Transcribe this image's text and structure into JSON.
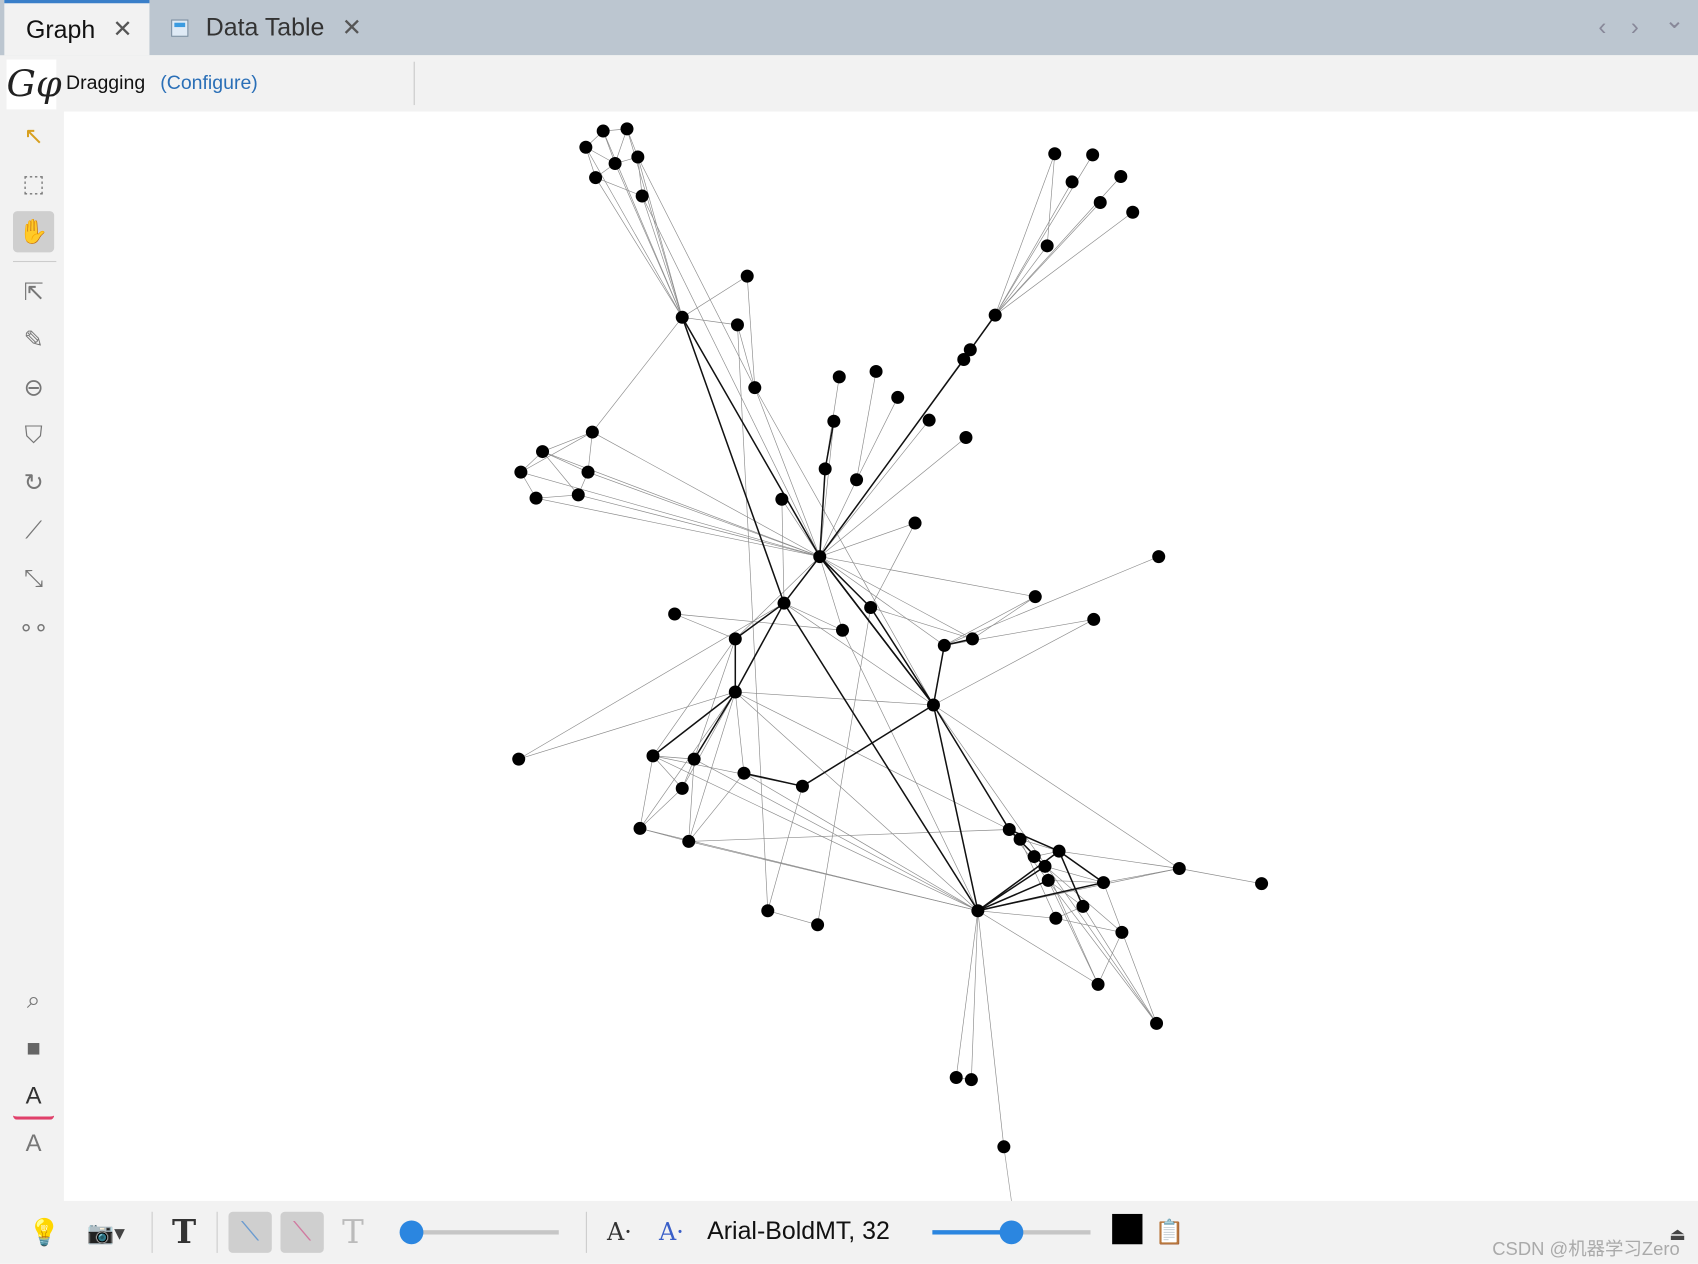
{
  "tabs": [
    {
      "label": "Graph",
      "close": "✕",
      "active": true
    },
    {
      "label": "Data Table",
      "close": "✕",
      "active": false
    }
  ],
  "nav": {
    "prev": "‹",
    "next": "›",
    "menu": "⌄"
  },
  "modebar": {
    "logo": "Gφ",
    "mode": "Dragging",
    "configure": "(Configure)"
  },
  "left_tools": [
    {
      "icon": "pointer-icon",
      "glyph": "↖"
    },
    {
      "icon": "rect-select-icon",
      "glyph": "⬚"
    },
    {
      "icon": "drag-hand-icon",
      "glyph": "✋",
      "selected": true
    },
    {
      "icon": "edit-node-icon",
      "glyph": "⇱"
    },
    {
      "icon": "brush-icon",
      "glyph": "✎"
    },
    {
      "icon": "size-icon",
      "glyph": "⊖"
    },
    {
      "icon": "paint-icon",
      "glyph": "⛉"
    },
    {
      "icon": "rotate-icon",
      "glyph": "↻"
    },
    {
      "icon": "add-node-icon",
      "glyph": "⟋"
    },
    {
      "icon": "add-edge-icon",
      "glyph": "⤡"
    },
    {
      "icon": "shortest-path-icon",
      "glyph": "∘∘"
    },
    {
      "icon": "zoom-center-icon",
      "glyph": "⌕"
    },
    {
      "icon": "background-color-icon",
      "glyph": "■"
    },
    {
      "icon": "label-color-icon",
      "glyph": "A"
    },
    {
      "icon": "label-size-icon",
      "glyph": "A"
    }
  ],
  "bottom": {
    "font": "Arial-BoldMT, 32",
    "edge_scale_percent": 0,
    "label_scale_percent": 48,
    "label_color": "#000000",
    "watermark": "CSDN @机器学习Zero"
  },
  "colors": {
    "accent": "#2b86e0",
    "link": "#2a6fb7",
    "tabbar": "#bcc6d0",
    "node": "#000000"
  }
}
